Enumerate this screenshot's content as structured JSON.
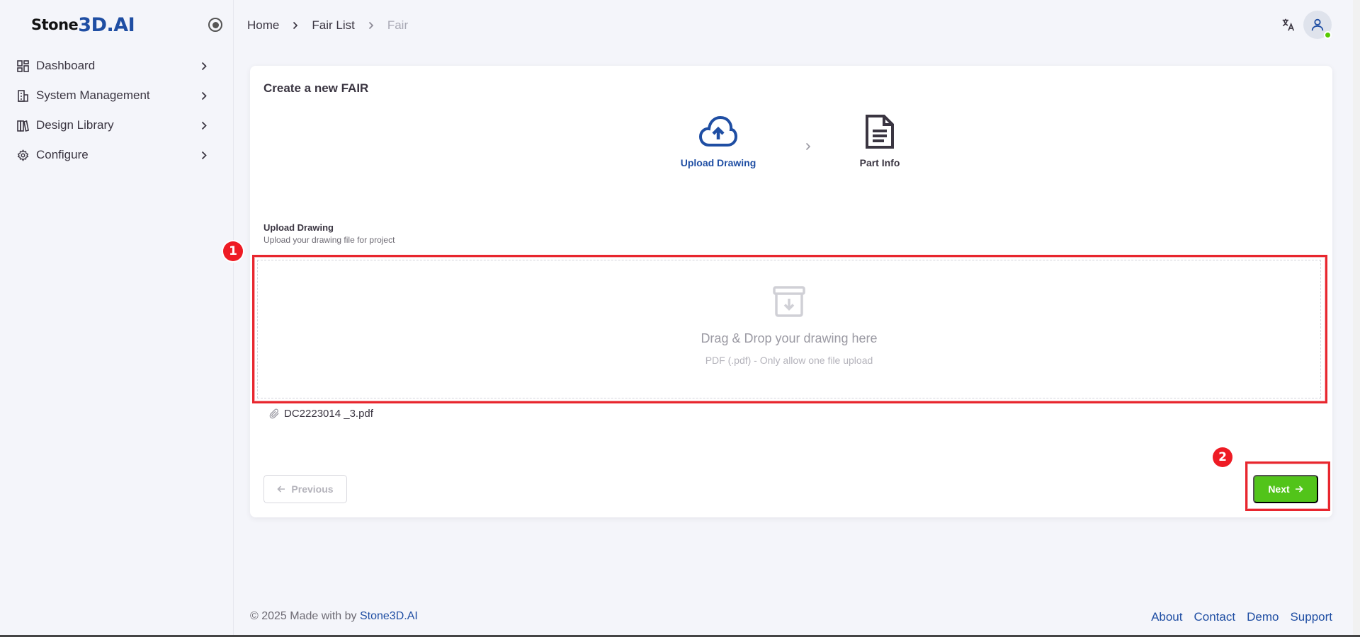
{
  "brand": {
    "part1": "Stone",
    "part2": "3D.AI"
  },
  "sidebar": {
    "items": [
      {
        "label": "Dashboard",
        "icon": "dashboard-icon"
      },
      {
        "label": "System Management",
        "icon": "building-icon"
      },
      {
        "label": "Design Library",
        "icon": "library-icon"
      },
      {
        "label": "Configure",
        "icon": "gear-icon"
      }
    ]
  },
  "breadcrumb": {
    "home": "Home",
    "list": "Fair List",
    "current": "Fair"
  },
  "card": {
    "title": "Create a new FAIR",
    "steps": [
      {
        "label": "Upload Drawing",
        "icon": "cloud-upload-icon",
        "state": "active"
      },
      {
        "label": "Part Info",
        "icon": "document-icon",
        "state": "inactive"
      }
    ],
    "section": {
      "title": "Upload Drawing",
      "subtitle": "Upload your drawing file for project"
    },
    "dropzone": {
      "title": "Drag & Drop your drawing here",
      "subtitle": "PDF (.pdf) - Only allow one file upload"
    },
    "file": {
      "name": "DC2223014 _3.pdf"
    },
    "buttons": {
      "previous": "Previous",
      "next": "Next"
    },
    "annotations": {
      "dropzone_badge": "1",
      "next_badge": "2"
    }
  },
  "footer": {
    "copy": "© 2025 Made with by ",
    "brand": "Stone3D.AI",
    "links": [
      "About",
      "Contact",
      "Demo",
      "Support"
    ]
  },
  "colors": {
    "accent": "#1f4ea3",
    "success": "#52c41a",
    "highlight": "#e8262e",
    "online": "#56ca00"
  }
}
